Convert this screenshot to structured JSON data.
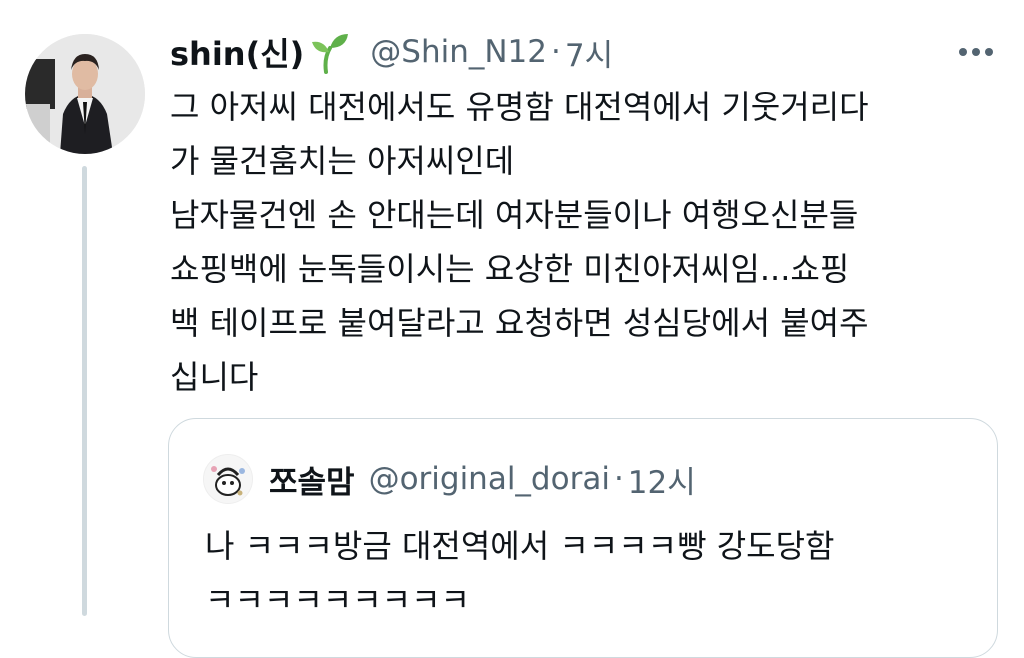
{
  "tweet": {
    "display_name": "shin(신)",
    "handle": "@Shin_N12",
    "separator": "·",
    "time": "7시",
    "lines": [
      "그 아저씨 대전에서도 유명함 대전역에서 기웃거리다",
      "가 물건훔치는 아저씨인데",
      "남자물건엔 손 안대는데 여자분들이나 여행오신분들",
      "쇼핑백에 눈독들이시는 요상한 미친아저씨임...쇼핑",
      "백 테이프로 붙여달라고 요청하면 성심당에서 붙여주",
      "십니다"
    ],
    "name_emoji": "sprout-icon"
  },
  "quote": {
    "display_name": "쪼솔맘",
    "handle": "@original_dorai",
    "separator": "·",
    "time": "12시",
    "lines": [
      "나 ㅋㅋㅋ방금 대전역에서 ㅋㅋㅋㅋ빵 강도당함",
      "ㅋㅋㅋㅋㅋㅋㅋㅋㅋ"
    ]
  },
  "colors": {
    "text": "#0f1419",
    "secondary": "#536471",
    "border": "#cfd9de",
    "sprout": "#5fb04a"
  }
}
